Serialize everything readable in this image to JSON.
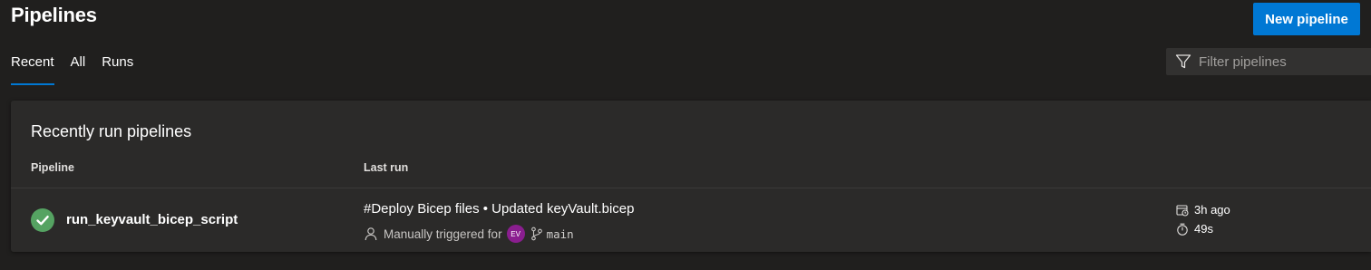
{
  "header": {
    "title": "Pipelines",
    "new_pipeline_label": "New pipeline"
  },
  "tabs": [
    {
      "label": "Recent",
      "active": true
    },
    {
      "label": "All",
      "active": false
    },
    {
      "label": "Runs",
      "active": false
    }
  ],
  "filter": {
    "placeholder": "Filter pipelines",
    "value": ""
  },
  "recent": {
    "title": "Recently run pipelines",
    "columns": {
      "pipeline": "Pipeline",
      "last_run": "Last run"
    },
    "rows": [
      {
        "status": "succeeded",
        "status_icon": "check-circle-icon",
        "pipeline_name": "run_keyvault_bicep_script",
        "run_title": "#Deploy Bicep files • Updated keyVault.bicep",
        "trigger_text": "Manually triggered for",
        "avatar_initials": "EV",
        "branch": "main",
        "time_ago": "3h ago",
        "duration": "49s"
      }
    ]
  },
  "colors": {
    "accent": "#0078d4",
    "success": "#55a362",
    "avatar": "#8a1e8f"
  }
}
